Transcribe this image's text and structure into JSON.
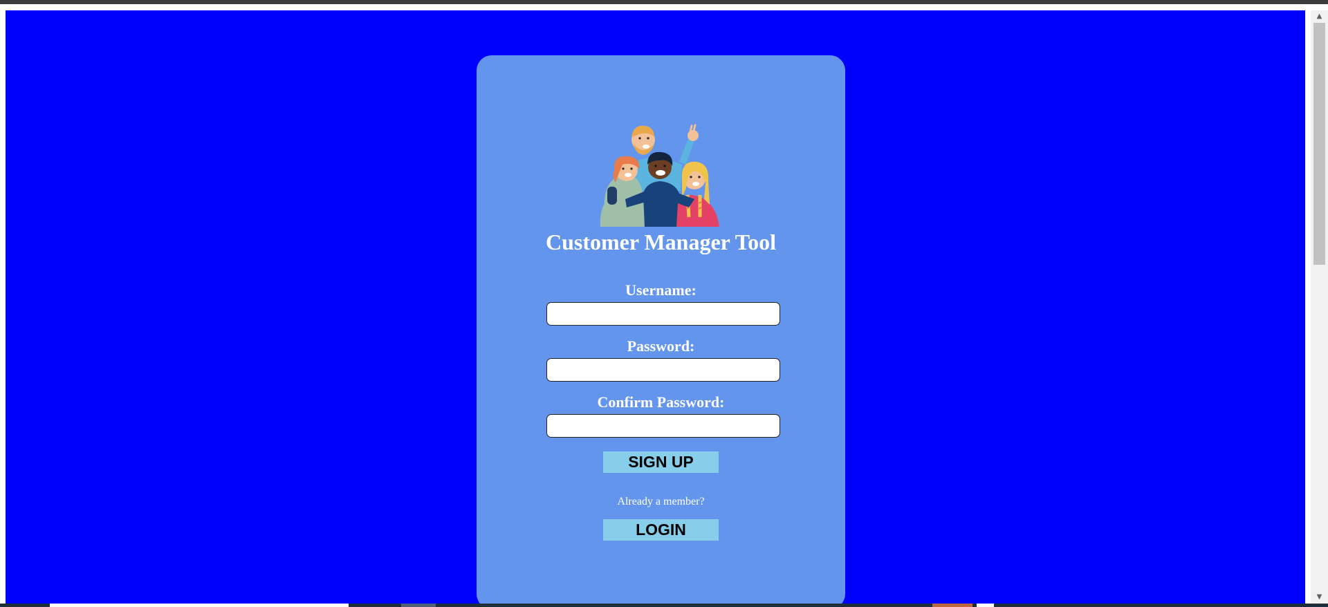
{
  "app": {
    "title": "Customer Manager Tool",
    "illustration_icon": "group-of-people-illustration"
  },
  "form": {
    "username_label": "Username:",
    "password_label": "Password:",
    "confirm_password_label": "Confirm Password:",
    "username_value": "",
    "password_value": "",
    "confirm_password_value": "",
    "signup_label": "SIGN UP",
    "member_text": "Already a member?",
    "login_label": "LOGIN"
  },
  "colors": {
    "page_background": "#0000ff",
    "card_background": "#6495ed",
    "button_background": "#87ceeb",
    "text": "#ffffff"
  }
}
